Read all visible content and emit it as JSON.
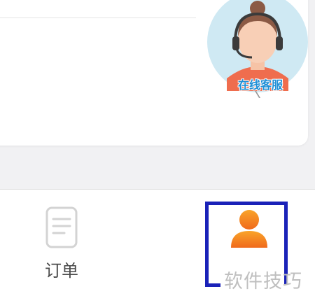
{
  "customer_service": {
    "label": "在线客服",
    "icon": "customer-service-avatar-icon"
  },
  "tabbar": {
    "orders": {
      "label": "订单",
      "icon": "document-icon"
    },
    "me": {
      "label": "",
      "icon": "person-icon"
    }
  },
  "watermark": {
    "text": "软件技巧"
  },
  "colors": {
    "accent_orange": "#f47a1f",
    "highlight_blue": "#1a22b8",
    "service_text": "#1f8fd6"
  }
}
